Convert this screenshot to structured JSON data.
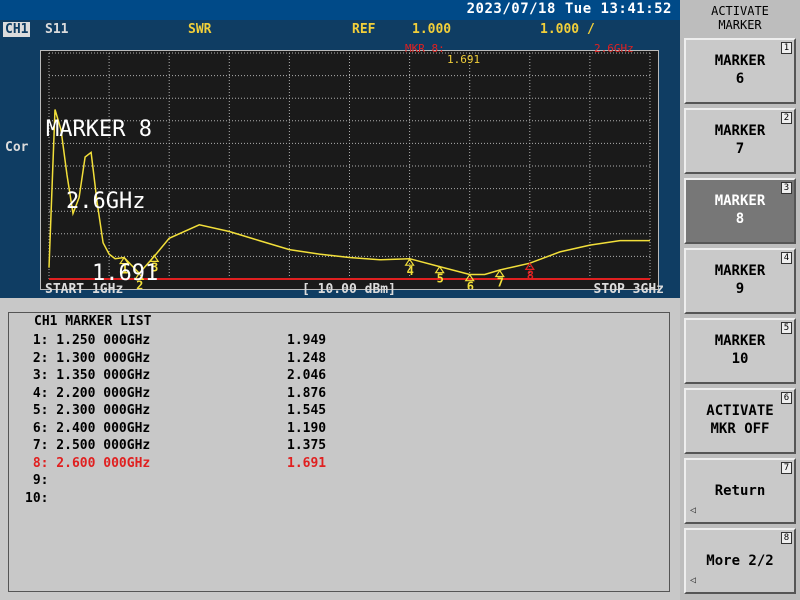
{
  "header": {
    "datetime": "2023/07/18 Tue 13:41:52",
    "channel": "CH1",
    "param": "S11",
    "format": "SWR",
    "ref_label": "REF",
    "ref_value": "1.000",
    "scale": "1.000 /"
  },
  "screen": {
    "side_label": "Cor",
    "marker_readout": {
      "title": "MARKER 8",
      "freq": "2.6GHz",
      "value": "1.691"
    },
    "mkr_label": "MKR 8:",
    "mkr_value": "1.691",
    "mkr_freq": "2.6GHz",
    "footer_start": "START 1GHz",
    "footer_power": "[ 10.00 dBm]",
    "footer_stop": "STOP 3GHz"
  },
  "chart_data": {
    "type": "line",
    "xlim": [
      1.0,
      3.0
    ],
    "ylim": [
      1.0,
      11.0
    ],
    "x_unit": "GHz",
    "y_format": "SWR",
    "grid": true,
    "x": [
      1.0,
      1.02,
      1.04,
      1.06,
      1.08,
      1.1,
      1.12,
      1.14,
      1.16,
      1.18,
      1.2,
      1.22,
      1.25,
      1.3,
      1.35,
      1.4,
      1.5,
      1.6,
      1.7,
      1.8,
      1.9,
      2.0,
      2.1,
      2.2,
      2.3,
      2.4,
      2.45,
      2.5,
      2.55,
      2.6,
      2.7,
      2.8,
      2.9,
      3.0
    ],
    "y": [
      1.5,
      8.5,
      7.6,
      5.6,
      3.9,
      4.6,
      6.4,
      6.6,
      4.4,
      2.6,
      2.1,
      1.9,
      1.95,
      1.25,
      2.0,
      2.8,
      3.4,
      3.1,
      2.7,
      2.3,
      2.1,
      1.95,
      1.85,
      1.9,
      1.55,
      1.2,
      1.2,
      1.4,
      1.55,
      1.7,
      2.2,
      2.5,
      2.7,
      2.7
    ],
    "markers": [
      {
        "id": "1",
        "freq": "1.250 000GHz",
        "value": "1.949"
      },
      {
        "id": "2",
        "freq": "1.300 000GHz",
        "value": "1.248"
      },
      {
        "id": "3",
        "freq": "1.350 000GHz",
        "value": "2.046"
      },
      {
        "id": "4",
        "freq": "2.200 000GHz",
        "value": "1.876"
      },
      {
        "id": "5",
        "freq": "2.300 000GHz",
        "value": "1.545"
      },
      {
        "id": "6",
        "freq": "2.400 000GHz",
        "value": "1.190"
      },
      {
        "id": "7",
        "freq": "2.500 000GHz",
        "value": "1.375"
      },
      {
        "id": "8",
        "freq": "2.600 000GHz",
        "value": "1.691"
      }
    ]
  },
  "marker_list": {
    "title": "CH1 MARKER LIST",
    "rows": [
      {
        "label": " 1: 1.250 000GHz",
        "value": "1.949",
        "active": false
      },
      {
        "label": " 2: 1.300 000GHz",
        "value": "1.248",
        "active": false
      },
      {
        "label": " 3: 1.350 000GHz",
        "value": "2.046",
        "active": false
      },
      {
        "label": " 4: 2.200 000GHz",
        "value": "1.876",
        "active": false
      },
      {
        "label": " 5: 2.300 000GHz",
        "value": "1.545",
        "active": false
      },
      {
        "label": " 6: 2.400 000GHz",
        "value": "1.190",
        "active": false
      },
      {
        "label": " 7: 2.500 000GHz",
        "value": "1.375",
        "active": false
      },
      {
        "label": " 8: 2.600 000GHz",
        "value": "1.691",
        "active": true
      },
      {
        "label": " 9:",
        "value": "",
        "active": false
      },
      {
        "label": "10:",
        "value": "",
        "active": false
      }
    ]
  },
  "softkeys": {
    "title": "ACTIVATE\nMARKER",
    "keys": [
      {
        "label": "MARKER\n6",
        "num": "1",
        "selected": false,
        "arrow": false
      },
      {
        "label": "MARKER\n7",
        "num": "2",
        "selected": false,
        "arrow": false
      },
      {
        "label": "MARKER\n8",
        "num": "3",
        "selected": true,
        "arrow": false
      },
      {
        "label": "MARKER\n9",
        "num": "4",
        "selected": false,
        "arrow": false
      },
      {
        "label": "MARKER\n10",
        "num": "5",
        "selected": false,
        "arrow": false
      },
      {
        "label": "ACTIVATE\nMKR OFF",
        "num": "6",
        "selected": false,
        "arrow": false
      },
      {
        "label": "Return",
        "num": "7",
        "selected": false,
        "arrow": true
      },
      {
        "label": "More 2/2",
        "num": "8",
        "selected": false,
        "arrow": true
      }
    ],
    "arrow_glyph": "◁"
  },
  "colors": {
    "trace": "#f2df3a",
    "active_marker": "#e02020",
    "grid": "#b0b0b0"
  }
}
